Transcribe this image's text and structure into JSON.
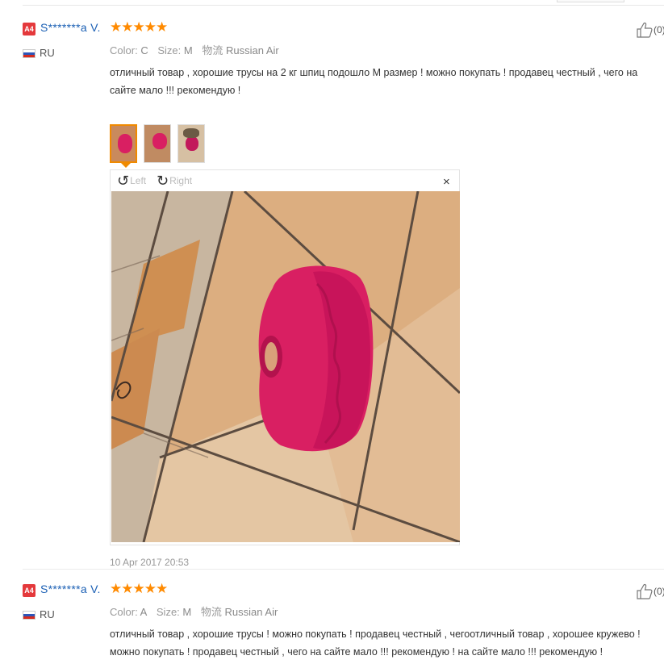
{
  "reviews": [
    {
      "level_badge": "A4",
      "user_name": "S*******a V.",
      "stars": "★★★★★",
      "country": "RU",
      "likes": "(0)",
      "attrs": {
        "color_key": "Color:",
        "color_val": "C",
        "size_key": "Size:",
        "size_val": "M",
        "ship_key": "物流",
        "ship_val": "Russian Air"
      },
      "comment": "отличный товар , хорошие трусы на 2 кг шпиц подошло М размер ! можно покупать ! продавец честный , чего на сайте мало !!! рекомендую !",
      "viewer": {
        "rotate_left": "Left",
        "rotate_right": "Right",
        "close": "×"
      },
      "date": "10 Apr 2017 20:53"
    },
    {
      "level_badge": "A4",
      "user_name": "S*******a V.",
      "stars": "★★★★★",
      "country": "RU",
      "likes": "(0)",
      "attrs": {
        "color_key": "Color:",
        "color_val": "A",
        "size_key": "Size:",
        "size_val": "M",
        "ship_key": "物流",
        "ship_val": "Russian Air"
      },
      "comment": "отличный товар , хорошие трусы ! можно покупать ! продавец честный , чегоотличный товар , хорошее кружево ! можно покупать ! продавец честный , чего на сайте мало !!! рекомендую ! на сайте мало !!! рекомендую !"
    }
  ],
  "colors": {
    "star": "#ff8a00",
    "badge": "#e4393c",
    "username": "#1a5fb4",
    "product": "#d91f62",
    "selected_thumb_border": "#f08a00"
  },
  "icons": {
    "like": "thumbs-up-icon",
    "rotate_left": "rotate-left-icon",
    "rotate_right": "rotate-right-icon",
    "close": "close-icon",
    "flag": "russia-flag-icon"
  }
}
